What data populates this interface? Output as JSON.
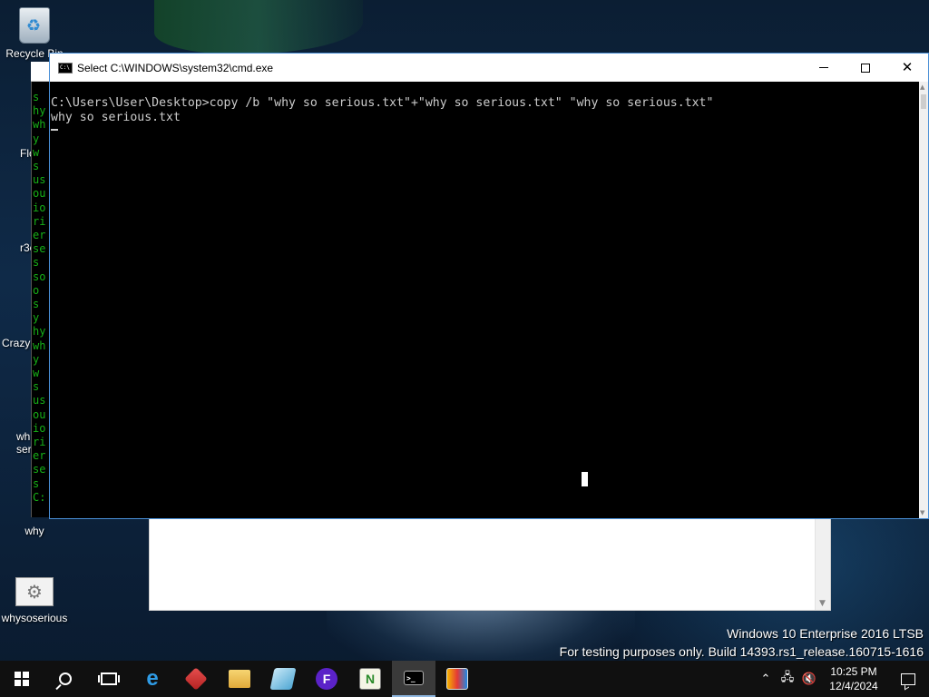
{
  "desktop": {
    "icons": [
      {
        "label": "Recycle Bin",
        "icon": "recycle-bin-icon"
      },
      {
        "label": "Flo",
        "icon": "floorp-icon"
      },
      {
        "label": "r3c",
        "icon": "app-icon"
      },
      {
        "label": "Crazy",
        "icon": "crazy-icon"
      },
      {
        "label": "wh ser",
        "icon": "text-file-icon"
      },
      {
        "label": "why",
        "icon": "file-icon"
      },
      {
        "label": "whysoserious",
        "icon": "gear-file-icon"
      }
    ]
  },
  "background_cmd": {
    "lines": [
      "s",
      "hy",
      "wh",
      "y ",
      "w",
      "s ",
      "us",
      "ou",
      "io",
      "ri",
      "er",
      "se",
      "s ",
      "so",
      "o ",
      "s ",
      "y ",
      "hy",
      "wh",
      "y ",
      "w",
      "s ",
      "us",
      "ou",
      "io",
      "ri",
      "er",
      "se",
      "s ",
      "C:"
    ]
  },
  "cmd_window": {
    "title": "Select C:\\WINDOWS\\system32\\cmd.exe",
    "lines": [
      "C:\\Users\\User\\Desktop>copy /b \"why so serious.txt\"+\"why so serious.txt\" \"why so serious.txt\"",
      "why so serious.txt"
    ]
  },
  "watermark": {
    "line1": "Windows 10 Enterprise 2016 LTSB",
    "line2": "For testing purposes only. Build 14393.rs1_release.160715-1616"
  },
  "taskbar": {
    "apps": [
      "start",
      "search",
      "task-view",
      "internet-explorer",
      "red-app",
      "file-explorer",
      "crazy-app",
      "floorp",
      "notepad-plus-plus",
      "command-prompt",
      "color-app"
    ],
    "active_app": "command-prompt",
    "clock_time": "10:25 PM",
    "clock_date": "12/4/2024"
  }
}
